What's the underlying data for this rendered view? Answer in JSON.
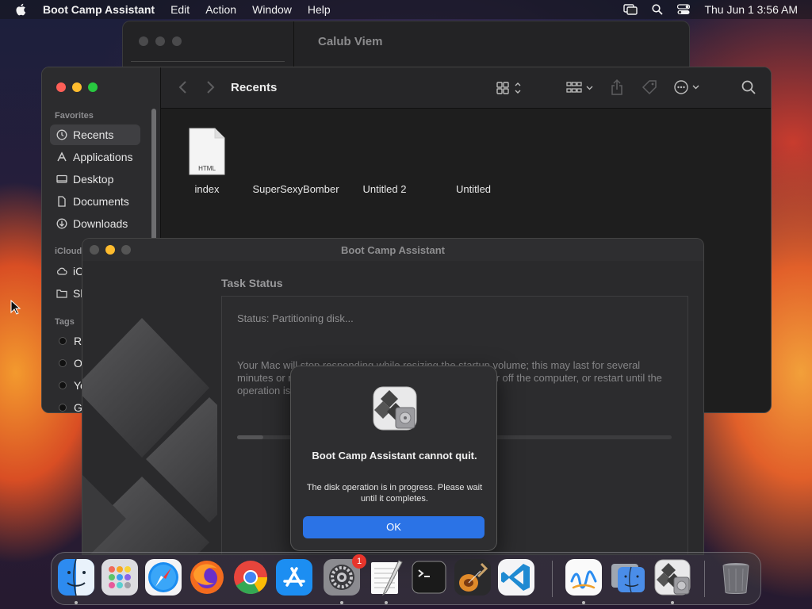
{
  "menubar": {
    "app_name": "Boot Camp Assistant",
    "menus": [
      "Edit",
      "Action",
      "Window",
      "Help"
    ],
    "clock": "Thu Jun 1  3:56 AM"
  },
  "back_window": {
    "title": "Calub Viem"
  },
  "finder": {
    "title": "Recents",
    "favorites_label": "Favorites",
    "favorites": [
      "Recents",
      "Applications",
      "Desktop",
      "Documents",
      "Downloads"
    ],
    "icloud_label": "iCloud",
    "icloud_items": [
      "iC",
      "Sh"
    ],
    "tags_label": "Tags",
    "tags": [
      "Re",
      "Or",
      "Ye",
      "Gr"
    ],
    "files": [
      {
        "name": "index",
        "badge": "HTML"
      },
      {
        "name": "SuperSexyBomber"
      },
      {
        "name": "Untitled 2"
      },
      {
        "name": "Untitled"
      }
    ]
  },
  "bootcamp": {
    "window_title": "Boot Camp Assistant",
    "heading": "Task Status",
    "status": "Status: Partitioning disk...",
    "description": "Your Mac will stop responding while resizing the startup volume; this may last for several minutes or more. Do not quit Boot Camp Assistant, power off the computer, or restart until the operation is complete.",
    "progress": 0.06
  },
  "alert": {
    "title": "Boot Camp Assistant cannot quit.",
    "message": "The disk operation is in progress. Please wait until it completes.",
    "ok_label": "OK"
  },
  "dock": {
    "apps": [
      "Finder",
      "Launchpad",
      "Safari",
      "Firefox",
      "Chrome",
      "App Store",
      "System Settings",
      "TextEdit",
      "Terminal",
      "GarageBand",
      "Visual Studio Code",
      "Freeform",
      "Migration Assistant",
      "Boot Camp Assistant",
      "Trash"
    ],
    "settings_badge": "1"
  }
}
